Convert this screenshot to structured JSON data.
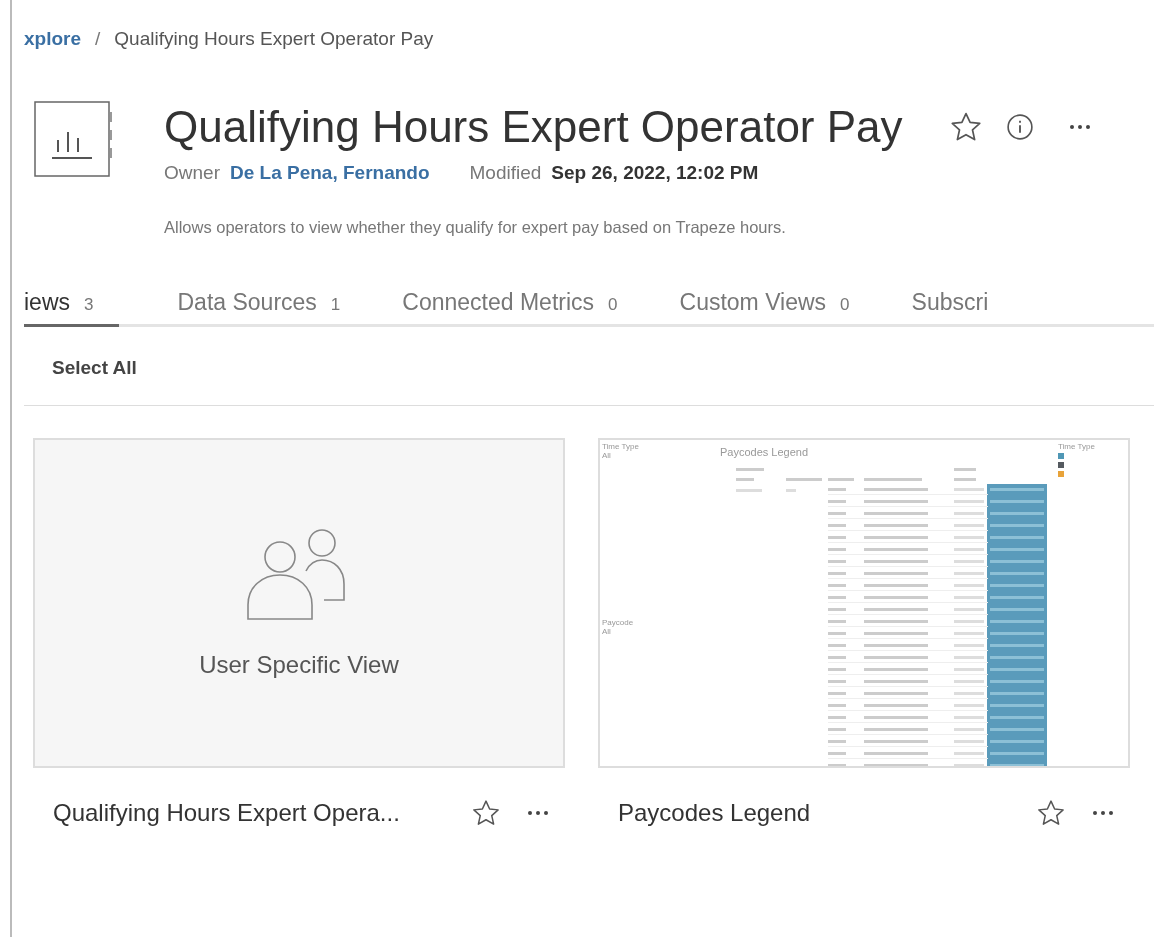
{
  "breadcrumb": {
    "parent": "xplore",
    "separator": "/",
    "current": "Qualifying Hours Expert Operator Pay"
  },
  "header": {
    "title": "Qualifying Hours Expert Operator Pay",
    "favorite": false,
    "owner_label": "Owner",
    "owner": "De La Pena, Fernando",
    "modified_label": "Modified",
    "modified": "Sep 26, 2022, 12:02 PM",
    "description": "Allows operators to view whether they qualify for expert pay based on Trapeze hours."
  },
  "tabs": [
    {
      "label": "iews",
      "count": "3",
      "selected": true
    },
    {
      "label": "Data Sources",
      "count": "1",
      "selected": false
    },
    {
      "label": "Connected Metrics",
      "count": "0",
      "selected": false
    },
    {
      "label": "Custom Views",
      "count": "0",
      "selected": false
    },
    {
      "label": "Subscri",
      "selected": false
    }
  ],
  "select_all": "Select All",
  "views": [
    {
      "kind": "placeholder",
      "thumbnail_label": "User Specific View",
      "name": "Qualifying Hours Expert Opera...",
      "favorite": false
    },
    {
      "kind": "thumbnail",
      "name": "Paycodes Legend",
      "favorite": false,
      "thumbnail": {
        "filter_1": "Time Type",
        "filter_1_value": "All",
        "title": "Paycodes Legend",
        "filter_2": "Paycode",
        "filter_2_value": "All",
        "legend_title": "Time Type",
        "legend": [
          {
            "color": "#4f97b5"
          },
          {
            "color": "#555a60"
          },
          {
            "color": "#e8a33a"
          }
        ]
      }
    }
  ]
}
